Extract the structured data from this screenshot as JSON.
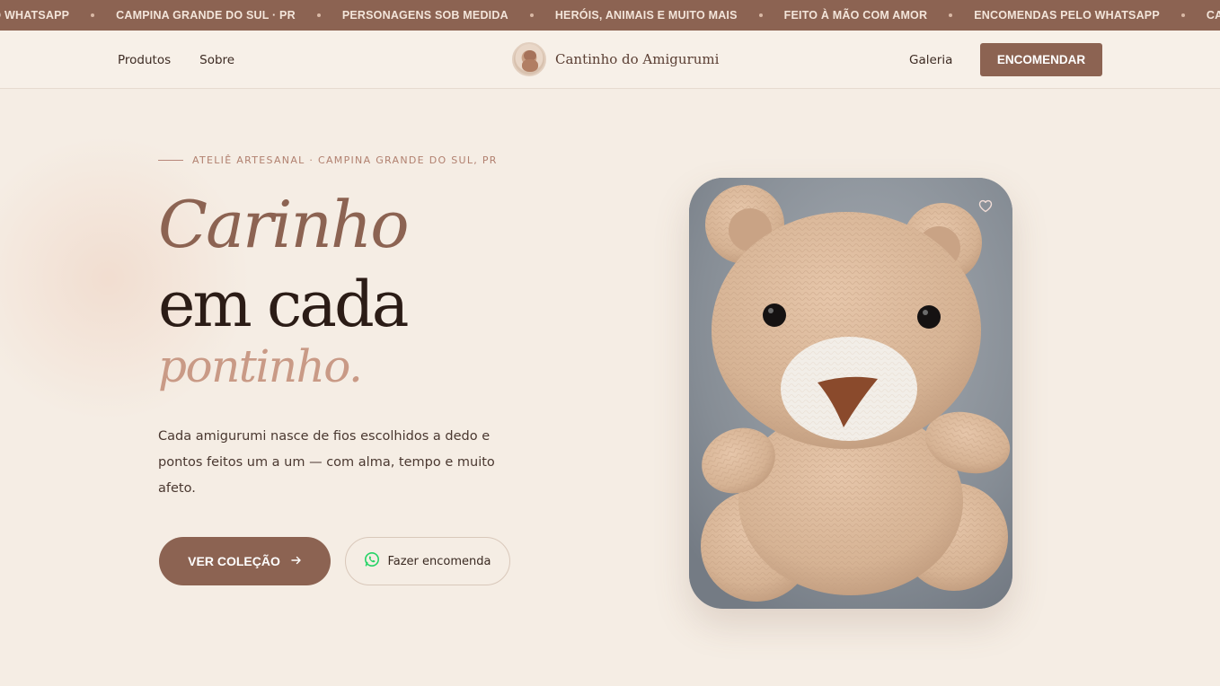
{
  "marquee": {
    "items": [
      "ELO WHATSAPP",
      "CAMPINA GRANDE DO SUL · PR",
      "PERSONAGENS SOB MEDIDA",
      "HERÓIS, ANIMAIS E MUITO MAIS",
      "FEITO À MÃO COM AMOR",
      "ENCOMENDAS PELO WHATSAPP",
      "CAMPINA G"
    ]
  },
  "header": {
    "nav_left": [
      "Produtos",
      "Sobre"
    ],
    "brand_name": "Cantinho do Amigurumi",
    "nav_right": "Galeria",
    "order_button": "ENCOMENDAR"
  },
  "hero": {
    "eyebrow": "ATELIÊ ARTESANAL · CAMPINA GRANDE DO SUL, PR",
    "title_line1": "Carinho",
    "title_line2": "em cada",
    "title_line3": "pontinho.",
    "description": "Cada amigurumi nasce de fios escolhidos a dedo e pontos feitos um a um — com alma, tempo e muito afeto.",
    "primary_button": "VER COLEÇÃO",
    "secondary_button": "Fazer encomenda"
  },
  "colors": {
    "brand": "#8c6352",
    "background": "#f5ede4",
    "whatsapp": "#25d366"
  },
  "icons": {
    "arrow": "arrow-right-icon",
    "whatsapp": "whatsapp-icon",
    "heart": "heart-icon",
    "logo": "bear-logo-icon"
  }
}
